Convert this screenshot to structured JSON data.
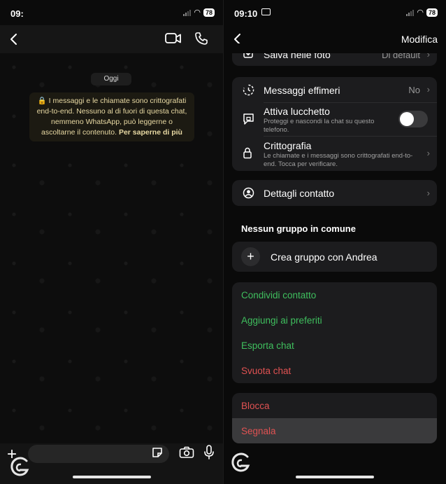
{
  "left": {
    "status": {
      "time": "09:",
      "battery": "78"
    },
    "chat": {
      "date_chip": "Oggi",
      "encryption_note": "I messaggi e le chiamate sono crittografati end-to-end. Nessuno al di fuori di questa chat, nemmeno WhatsApp, può leggerne o ascoltarne il contenuto.",
      "learn_more": "Per saperne di più"
    }
  },
  "right": {
    "status": {
      "time": "09:10",
      "battery": "78"
    },
    "header": {
      "edit_label": "Modifica"
    },
    "top_row": {
      "label": "Salva nelle foto",
      "value": "Di default"
    },
    "privacy": {
      "disappearing": {
        "label": "Messaggi effimeri",
        "value": "No"
      },
      "lock": {
        "label": "Attiva lucchetto",
        "subtitle": "Proteggi e nascondi la chat su questo telefono.",
        "enabled": false
      },
      "encryption": {
        "label": "Crittografia",
        "subtitle": "Le chiamate e i messaggi sono crittografati end-to-end. Tocca per verificare."
      }
    },
    "contact_details": "Dettagli contatto",
    "groups_title": "Nessun gruppo in comune",
    "create_group": "Crea gruppo con Andrea",
    "actions_green": [
      "Condividi contatto",
      "Aggiungi ai preferiti",
      "Esporta chat"
    ],
    "clear_chat": "Svuota chat",
    "block": "Blocca",
    "report": "Segnala"
  },
  "colors": {
    "accent_green": "#3fbf5e",
    "destructive_red": "#e05252",
    "card": "#1c1c1e"
  }
}
